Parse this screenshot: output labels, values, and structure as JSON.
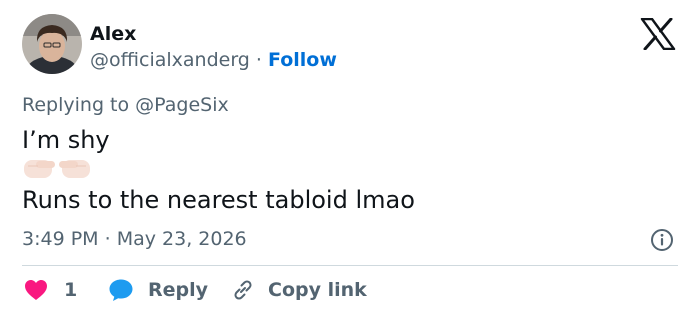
{
  "author": {
    "name": "Alex",
    "handle": "@officialxanderg",
    "separator": "·",
    "follow_label": "Follow"
  },
  "reply_context": {
    "prefix": "Replying to",
    "mention": "@PageSix"
  },
  "body": {
    "line1": "I’m shy",
    "emoji": "👉👈",
    "line2": "Runs to the nearest tabloid lmao"
  },
  "meta": {
    "time": "3:49 PM",
    "separator": "·",
    "date": "May 23, 2026"
  },
  "actions": {
    "like_count": "1",
    "reply_label": "Reply",
    "copy_label": "Copy link"
  },
  "colors": {
    "text": "#0f1419",
    "secondary": "#536471",
    "link": "#006fd6",
    "like": "#f91880",
    "reply_icon": "#1d9bf0",
    "divider": "#cfd9de"
  },
  "icons": [
    "x-logo-icon",
    "info-icon",
    "heart-icon",
    "reply-bubble-icon",
    "link-icon"
  ]
}
